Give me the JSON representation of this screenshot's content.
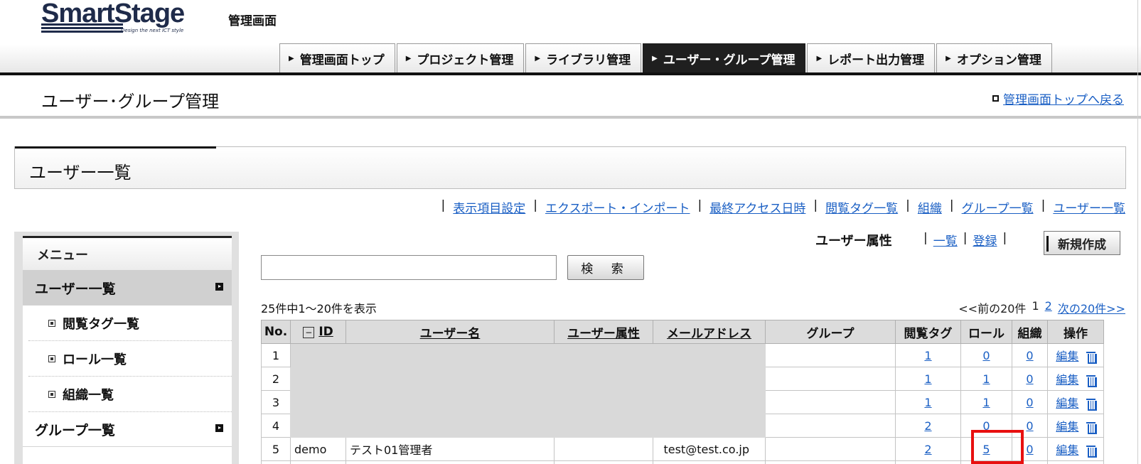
{
  "header": {
    "logo_text": "SmartStage",
    "logo_tagline": "Design the next ICT style",
    "admin_label": "管理画面",
    "nav_tabs": [
      {
        "label": "管理画面トップ",
        "active": false
      },
      {
        "label": "プロジェクト管理",
        "active": false
      },
      {
        "label": "ライブラリ管理",
        "active": false
      },
      {
        "label": "ユーザー・グループ管理",
        "active": true
      },
      {
        "label": "レポート出力管理",
        "active": false
      },
      {
        "label": "オプション管理",
        "active": false
      }
    ]
  },
  "page": {
    "title": "ユーザー･グループ管理",
    "back_link": "管理画面トップへ戻る",
    "section_title": "ユーザー一覧"
  },
  "links_row": [
    "表示項目設定",
    "エクスポート・インポート",
    "最終アクセス日時",
    "閲覧タグ一覧",
    "組織",
    "グループ一覧",
    "ユーザー一覧"
  ],
  "sidemenu": {
    "heading": "メニュー",
    "items": [
      {
        "label": "ユーザー一覧",
        "active": true
      },
      {
        "label": "閲覧タグ一覧",
        "sub": true
      },
      {
        "label": "ロール一覧",
        "sub": true
      },
      {
        "label": "組織一覧",
        "sub": true
      },
      {
        "label": "グループ一覧",
        "active": false
      }
    ]
  },
  "toolbar": {
    "attr_label": "ユーザー属性",
    "attr_list_link": "一覧",
    "attr_register_link": "登録",
    "new_button": "新規作成",
    "search_placeholder": "",
    "search_button": "検 索"
  },
  "listing": {
    "count_text": "25件中1～20件を表示",
    "pager_prev": "<<前の20件",
    "pager_page1": "1",
    "pager_page2": "2",
    "pager_next": "次の20件>>"
  },
  "table": {
    "headers": {
      "no": "No.",
      "id": "ID",
      "user_name": "ユーザー名",
      "user_attr": "ユーザー属性",
      "email": "メールアドレス",
      "group": "グループ",
      "view_tag": "閲覧タグ",
      "role": "ロール",
      "org": "組織",
      "ops": "操作"
    },
    "edit_label": "編集",
    "rows": [
      {
        "no": "1",
        "id": "",
        "name": "",
        "attr": "",
        "email": "",
        "group": "",
        "tag": "1",
        "role": "0",
        "org": "0"
      },
      {
        "no": "2",
        "id": "",
        "name": "",
        "attr": "",
        "email": "",
        "group": "",
        "tag": "1",
        "role": "1",
        "org": "0"
      },
      {
        "no": "3",
        "id": "",
        "name": "",
        "attr": "",
        "email": "",
        "group": "",
        "tag": "1",
        "role": "1",
        "org": "0"
      },
      {
        "no": "4",
        "id": "",
        "name": "",
        "attr": "",
        "email": "",
        "group": "",
        "tag": "2",
        "role": "0",
        "org": "0"
      },
      {
        "no": "5",
        "id": "demo",
        "name": "テスト01管理者",
        "attr": "",
        "email": "test@test.co.jp",
        "group": "",
        "tag": "2",
        "role": "5",
        "org": "0"
      }
    ]
  },
  "colors": {
    "accent_link": "#1a5fc4",
    "highlight": "#e81010",
    "nav_active_bg": "#1f1f1f"
  }
}
